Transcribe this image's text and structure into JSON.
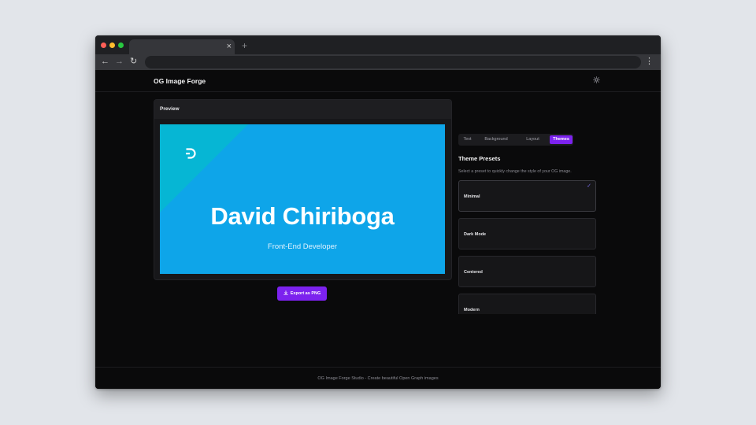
{
  "browser": {
    "tab_close": "×",
    "new_tab": "+",
    "nav_back": "←",
    "nav_forward": "→",
    "nav_reload": "↻",
    "menu": "⋮",
    "traffic_colors": [
      "#ff5f57",
      "#febc2e",
      "#28c840"
    ]
  },
  "header": {
    "brand": "OG Image Forge",
    "theme_icon": "sun-icon"
  },
  "preview": {
    "title": "Preview",
    "og": {
      "name": "David Chiriboga",
      "role": "Front-End Developer",
      "background": "#0ea5e9",
      "accent": "#06b6d4",
      "logo_icon": "logo-icon"
    }
  },
  "export": {
    "label": "Export as PNG",
    "icon": "download-icon"
  },
  "sidebar": {
    "tabs": [
      {
        "label": "Text",
        "active": false
      },
      {
        "label": "Background",
        "active": false
      },
      {
        "label": "Layout",
        "active": false
      },
      {
        "label": "Themes",
        "active": true
      }
    ],
    "title": "Theme Presets",
    "description": "Select a preset to quickly change the style of your OG image.",
    "presets": [
      {
        "label": "Minimal",
        "selected": true
      },
      {
        "label": "Dark Mode",
        "selected": false
      },
      {
        "label": "Centered",
        "selected": false
      },
      {
        "label": "Modern",
        "selected": false
      }
    ],
    "check": "✓"
  },
  "footer": {
    "text": "OG Image Forge Studio - Create beautiful Open Graph images"
  },
  "colors": {
    "accent": "#7c22ee",
    "page_bg": "#0a0a0b"
  }
}
